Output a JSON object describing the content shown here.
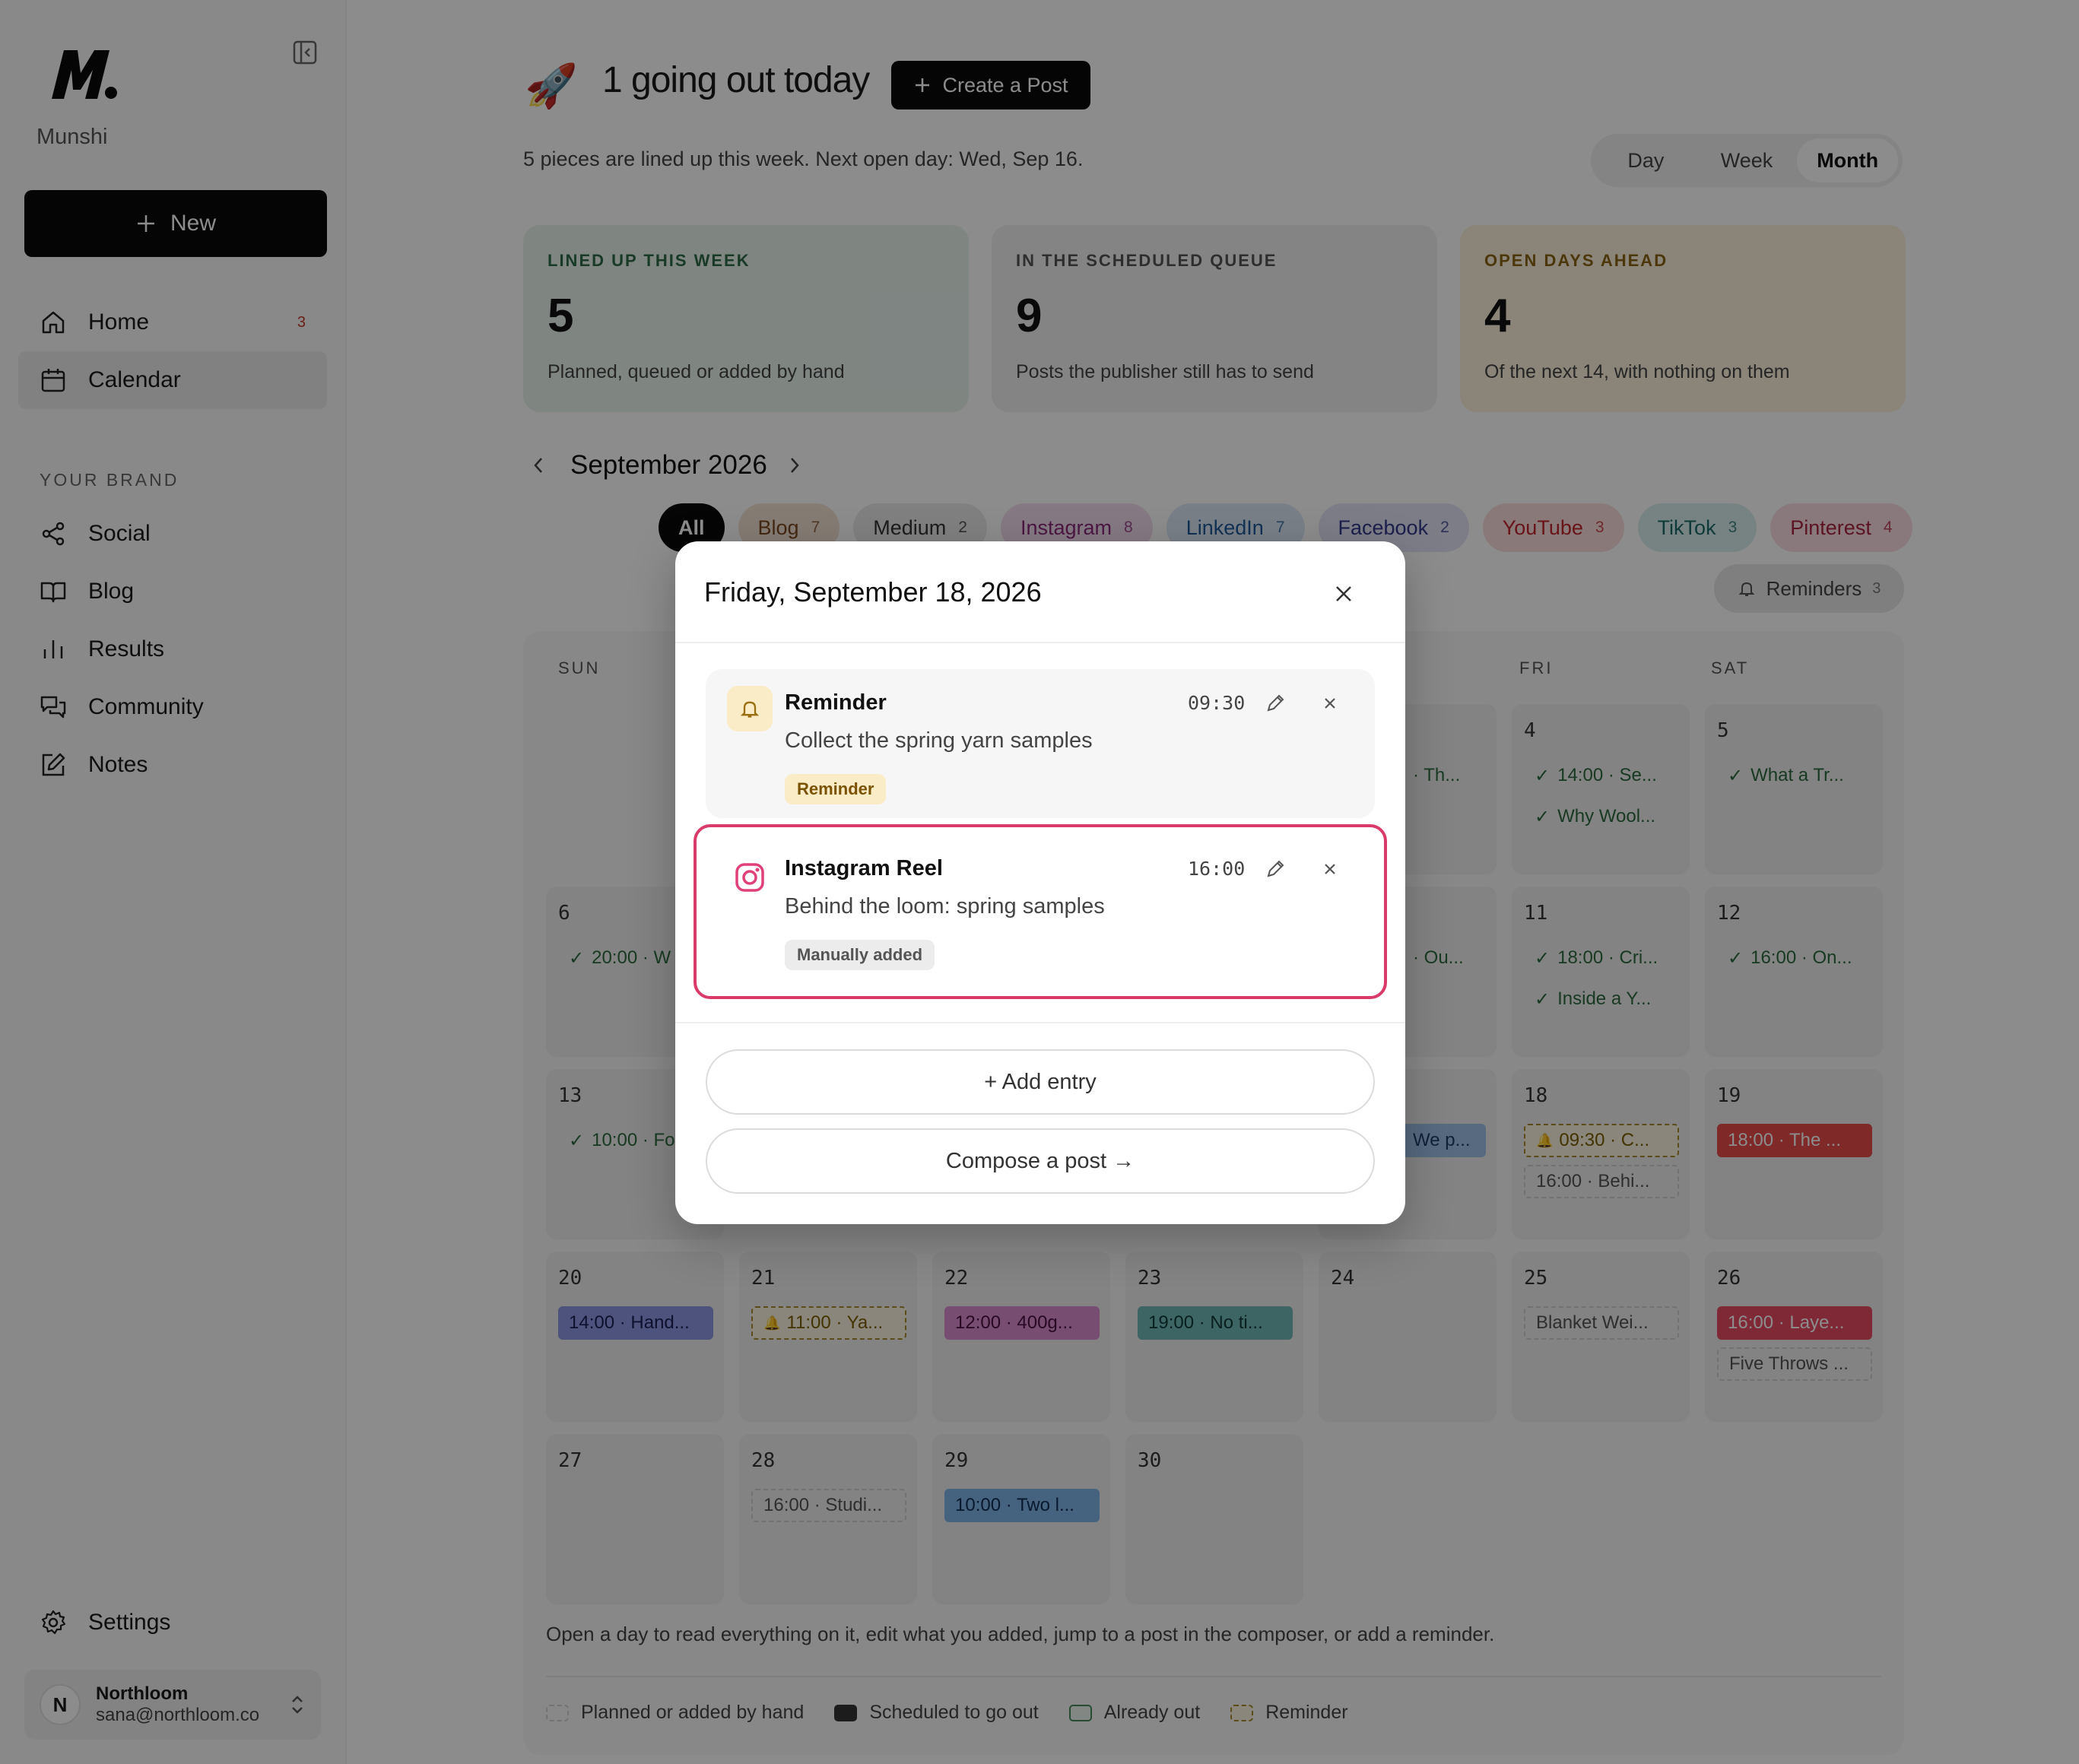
{
  "sidebar": {
    "brand": "Munshi",
    "new_label": "New",
    "nav": [
      {
        "label": "Home",
        "badge": "3"
      },
      {
        "label": "Calendar"
      }
    ],
    "section_label": "YOUR BRAND",
    "brand_nav": [
      {
        "label": "Social"
      },
      {
        "label": "Blog"
      },
      {
        "label": "Results"
      },
      {
        "label": "Community"
      },
      {
        "label": "Notes"
      }
    ],
    "settings_label": "Settings",
    "account": {
      "initial": "N",
      "name": "Northloom",
      "email": "sana@northloom.co"
    }
  },
  "header": {
    "headline": "1 going out today",
    "create_label": "Create a Post",
    "subline": "5 pieces are lined up this week. Next open day: Wed, Sep 16.",
    "views": [
      "Day",
      "Week",
      "Month"
    ],
    "active_view": "Month"
  },
  "stats": [
    {
      "label": "LINED UP THIS WEEK",
      "value": "5",
      "desc": "Planned, queued or added by hand",
      "color": "#e8f2ec",
      "label_color": "#2e6b45"
    },
    {
      "label": "IN THE SCHEDULED QUEUE",
      "value": "9",
      "desc": "Posts the publisher still has to send",
      "color": "#f1f1f1",
      "label_color": "#555555"
    },
    {
      "label": "OPEN DAYS AHEAD",
      "value": "4",
      "desc": "Of the next 14, with nothing on them",
      "color": "#fbf1dd",
      "label_color": "#8a6414"
    }
  ],
  "calendar": {
    "month": "September 2026",
    "filters": [
      {
        "label": "All",
        "count": "",
        "bg": "#0a0a0a",
        "fg": "#ffffff"
      },
      {
        "label": "Blog",
        "count": "7",
        "bg": "#f3e2d3",
        "fg": "#7a4a22"
      },
      {
        "label": "Medium",
        "count": "2",
        "bg": "#e9e9e9",
        "fg": "#333333"
      },
      {
        "label": "Instagram",
        "count": "8",
        "bg": "#f3dcf0",
        "fg": "#8a2a7a"
      },
      {
        "label": "LinkedIn",
        "count": "7",
        "bg": "#dce8f6",
        "fg": "#1f5a9a"
      },
      {
        "label": "Facebook",
        "count": "2",
        "bg": "#e2e4f6",
        "fg": "#333a8a"
      },
      {
        "label": "YouTube",
        "count": "3",
        "bg": "#fadcdc",
        "fg": "#c0262d"
      },
      {
        "label": "TikTok",
        "count": "3",
        "bg": "#d9eeee",
        "fg": "#1e6a6a"
      },
      {
        "label": "Pinterest",
        "count": "4",
        "bg": "#fadde2",
        "fg": "#a8243e"
      }
    ],
    "reminders_label": "Reminders",
    "reminders_count": "3",
    "weekdays": [
      "SUN",
      "FRI",
      "SAT"
    ],
    "days": [
      {
        "num": "4",
        "events": [
          {
            "text": "14:00 · Se...",
            "kind": "out"
          },
          {
            "text": "Why Wool...",
            "kind": "out"
          }
        ]
      },
      {
        "num": "5",
        "events": [
          {
            "text": "What a Tr...",
            "kind": "out"
          }
        ]
      },
      {
        "num": "6",
        "events": [
          {
            "text": "20:00 · W",
            "kind": "out"
          }
        ]
      },
      {
        "num": "11",
        "events": [
          {
            "text": "18:00 · Cri...",
            "kind": "out"
          },
          {
            "text": "Inside a Y...",
            "kind": "out"
          }
        ]
      },
      {
        "num": "12",
        "events": [
          {
            "text": "16:00 · On...",
            "kind": "out"
          }
        ]
      },
      {
        "num": "13",
        "events": [
          {
            "text": "10:00 · Fo",
            "kind": "out"
          }
        ]
      },
      {
        "num": "18",
        "events": [
          {
            "text": "09:30 · C...",
            "kind": "rem"
          },
          {
            "text": "16:00 · Behi...",
            "kind": "manual"
          }
        ]
      },
      {
        "num": "19",
        "events": [
          {
            "text": "18:00 · The ...",
            "kind": "sched",
            "bg": "#e84b4b",
            "fg": "#ffffff"
          }
        ]
      },
      {
        "num": "20",
        "events": [
          {
            "text": "14:00 · Hand...",
            "kind": "sched",
            "bg": "#8e98e6",
            "fg": "#1a1f55"
          }
        ]
      },
      {
        "num": "21",
        "events": [
          {
            "text": "11:00 · Ya...",
            "kind": "rem"
          }
        ]
      },
      {
        "num": "22",
        "events": [
          {
            "text": "12:00 · 400g...",
            "kind": "sched",
            "bg": "#d98fd0",
            "fg": "#4a1040"
          }
        ]
      },
      {
        "num": "23",
        "events": [
          {
            "text": "19:00 · No ti...",
            "kind": "sched",
            "bg": "#6fb9b6",
            "fg": "#0f3a38"
          }
        ]
      },
      {
        "num": "24",
        "events": []
      },
      {
        "num": "25",
        "events": [
          {
            "text": "Blanket Wei...",
            "kind": "manual"
          }
        ]
      },
      {
        "num": "26",
        "events": [
          {
            "text": "16:00 · Laye...",
            "kind": "sched",
            "bg": "#e84b64",
            "fg": "#ffffff"
          },
          {
            "text": "Five Throws ...",
            "kind": "manual"
          }
        ]
      },
      {
        "num": "27",
        "events": []
      },
      {
        "num": "28",
        "events": [
          {
            "text": "16:00 · Studi...",
            "kind": "manual"
          }
        ]
      },
      {
        "num": "29",
        "events": [
          {
            "text": "10:00 · Two l...",
            "kind": "sched",
            "bg": "#7fb3e8",
            "fg": "#0f2e55"
          }
        ]
      },
      {
        "num": "30",
        "events": []
      }
    ],
    "peek": [
      {
        "text": "· Th..."
      },
      {
        "text": "· Ou..."
      },
      {
        "text": "We p..."
      }
    ],
    "note": "Open a day to read everything on it, edit what you added, jump to a post in the composer, or add a reminder.",
    "legend": [
      {
        "label": "Planned or added by hand"
      },
      {
        "label": "Scheduled to go out"
      },
      {
        "label": "Already out"
      },
      {
        "label": "Reminder"
      }
    ]
  },
  "modal": {
    "title": "Friday, September 18, 2026",
    "entries": [
      {
        "title": "Reminder",
        "body": "Collect the spring yarn samples",
        "time": "09:30",
        "tag": "Reminder",
        "icon": "bell-icon"
      },
      {
        "title": "Instagram Reel",
        "body": "Behind the loom: spring samples",
        "time": "16:00",
        "tag": "Manually added",
        "icon": "instagram-icon"
      }
    ],
    "add_label": "+ Add entry",
    "compose_label": "Compose a post →"
  }
}
